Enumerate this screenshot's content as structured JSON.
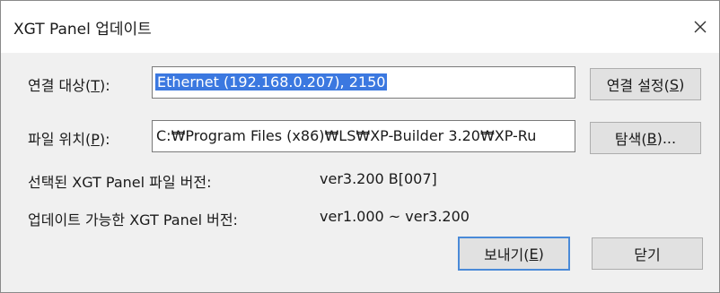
{
  "window": {
    "title": "XGT Panel 업데이트",
    "close_glyph": "✕"
  },
  "connection": {
    "label": "연결 대상(",
    "label_mnemonic": "T",
    "label_suffix": "):",
    "value": "Ethernet (192.168.0.207), 2150",
    "settings_button": "연결 설정(",
    "settings_mnemonic": "S",
    "settings_suffix": ")"
  },
  "file": {
    "label": "파일 위치(",
    "label_mnemonic": "P",
    "label_suffix": "):",
    "value": "C:₩Program Files (x86)₩LS₩XP-Builder 3.20₩XP-Ru",
    "browse_button": "탐색(",
    "browse_mnemonic": "B",
    "browse_suffix": ")..."
  },
  "info": {
    "selected_label": "선택된 XGT Panel 파일 버전:",
    "selected_value": "ver3.200 B[007]",
    "updatable_label": "업데이트 가능한 XGT Panel 버전:",
    "updatable_value": "ver1.000 ~ ver3.200"
  },
  "actions": {
    "send": "보내기(",
    "send_mnemonic": "E",
    "send_suffix": ")",
    "close": "닫기"
  }
}
